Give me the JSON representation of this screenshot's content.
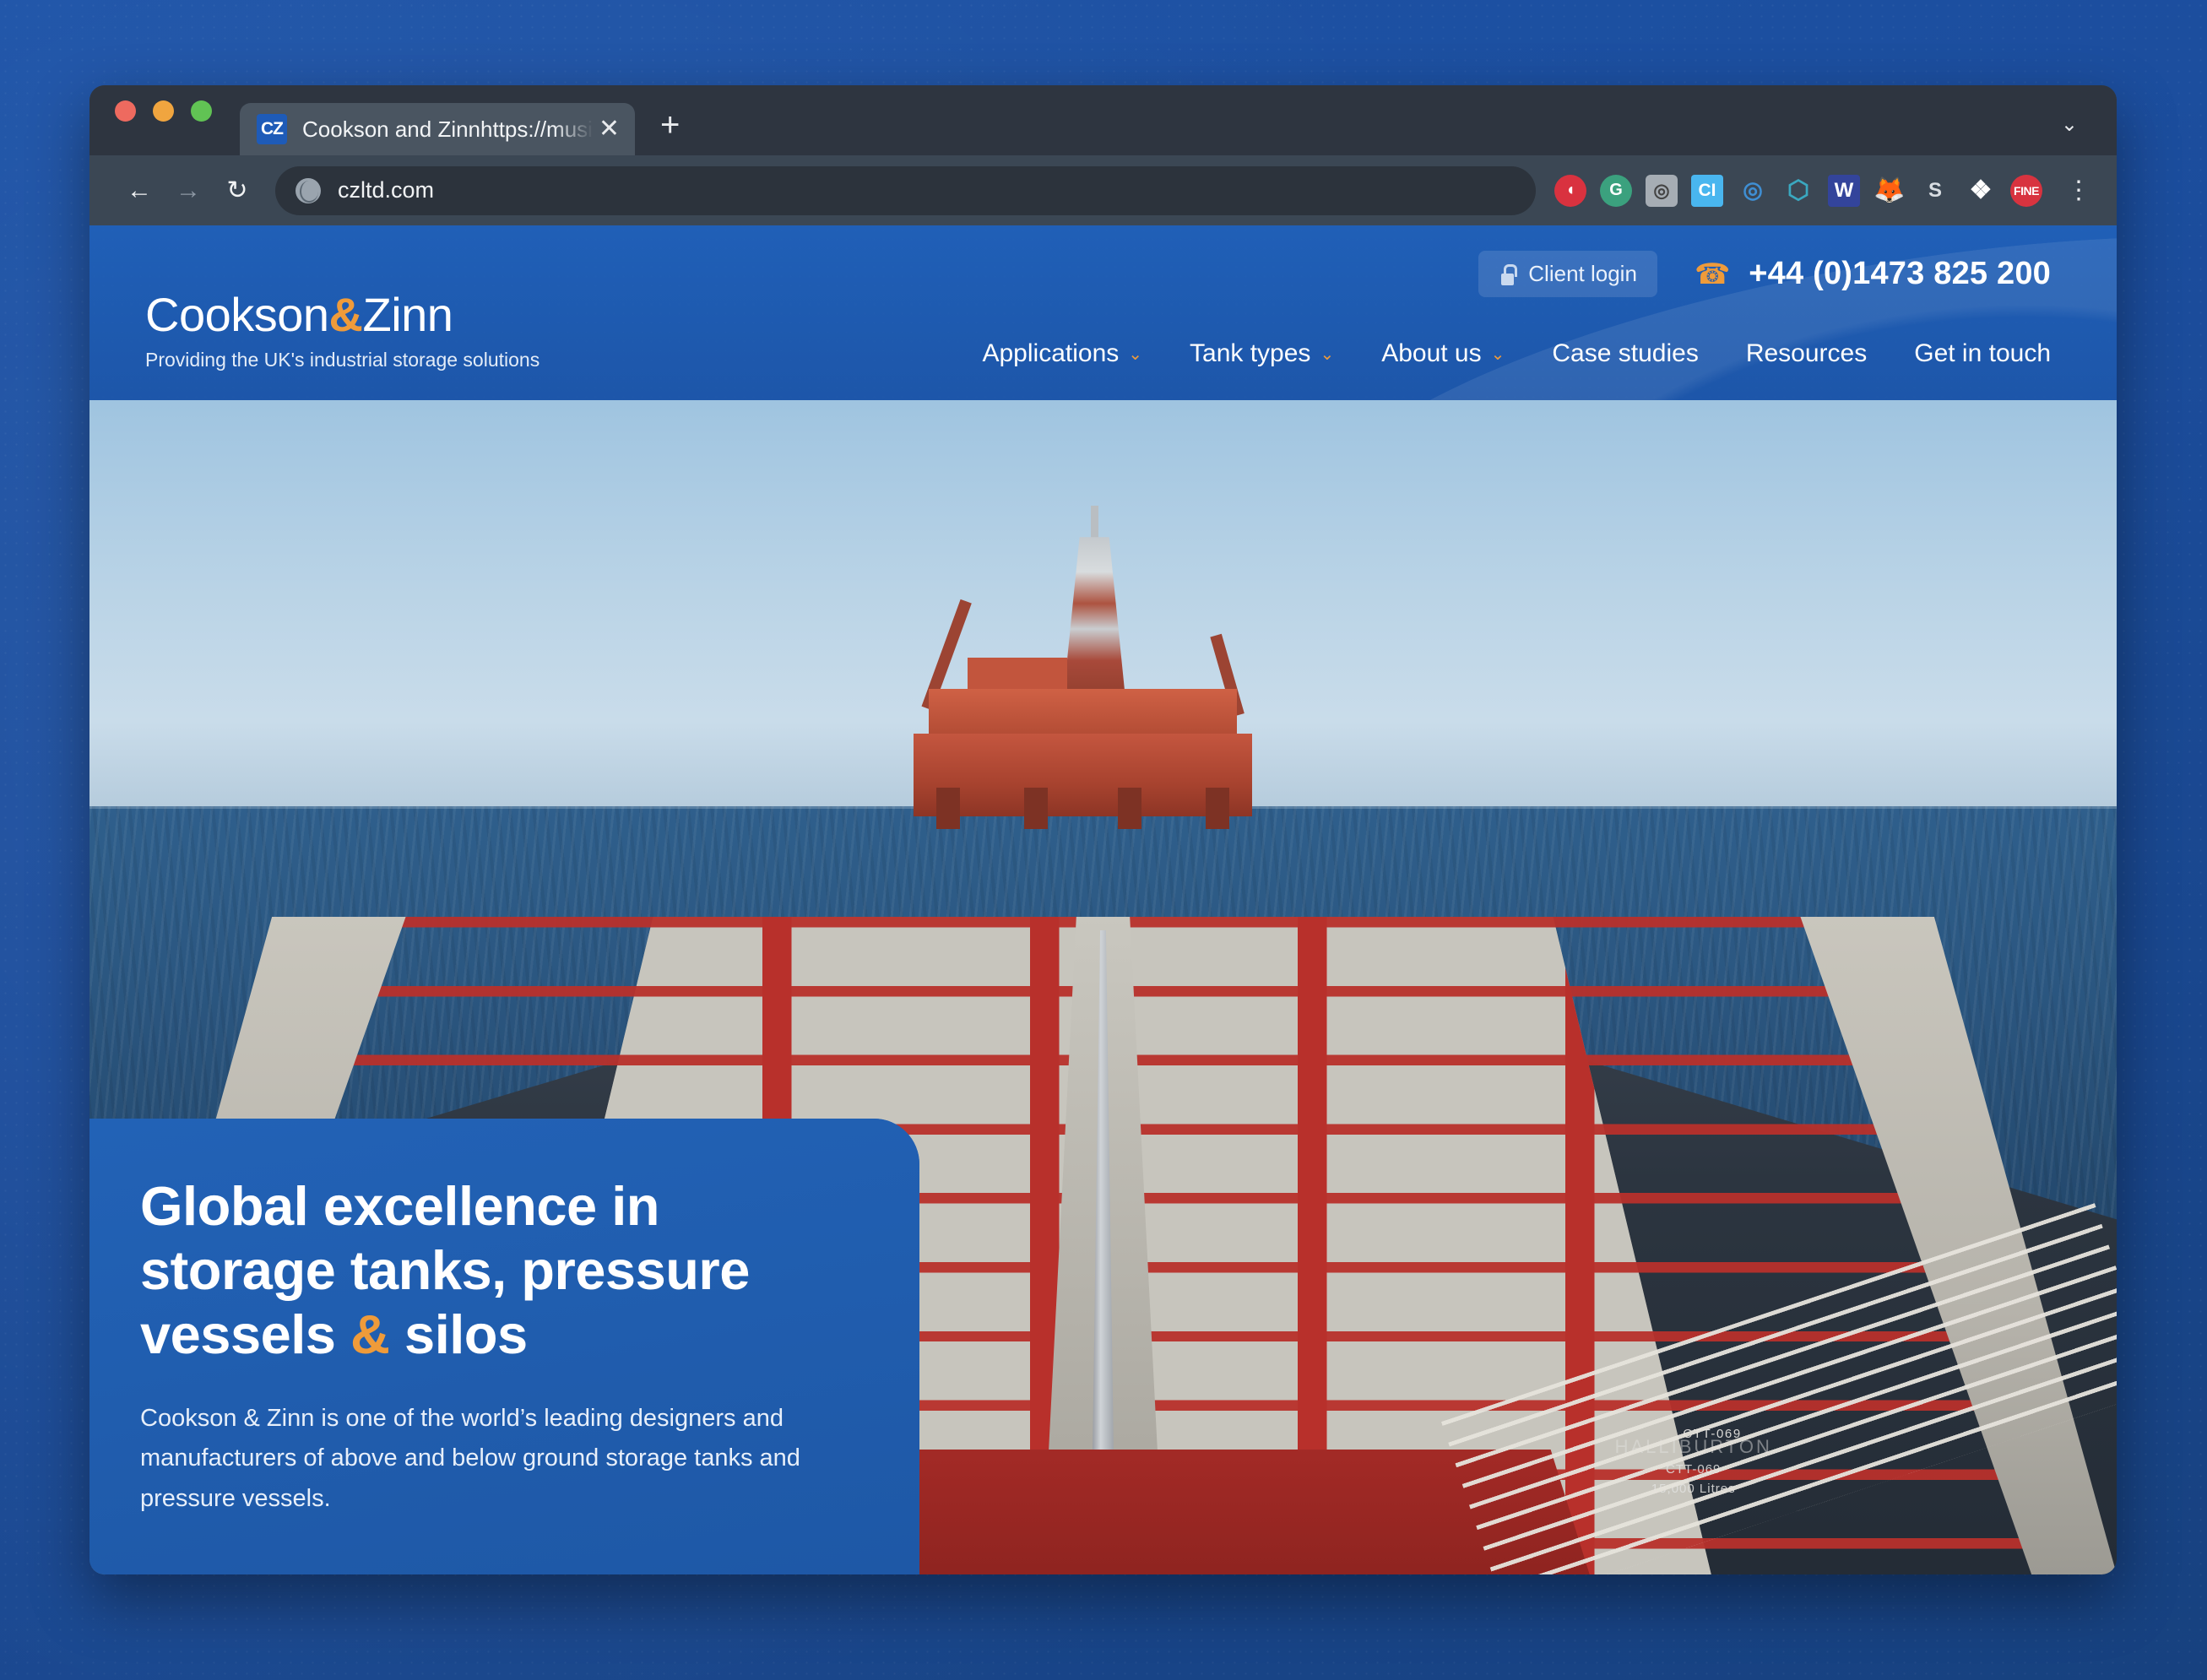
{
  "desktop": {
    "background_color": "#1b4c9b"
  },
  "browser": {
    "tab": {
      "favicon_text": "CZ",
      "title": "Cookson and Zinnhttps://musin",
      "close_label": "✕"
    },
    "new_tab_label": "+",
    "tab_search_icon": "⌄",
    "toolbar": {
      "back_label": "←",
      "forward_label": "→",
      "reload_label": "↻",
      "url": "czltd.com",
      "menu_label": "⋮"
    },
    "extensions": [
      {
        "name": "pocket-extension",
        "glyph": "◖"
      },
      {
        "name": "grammarly-extension",
        "glyph": "G"
      },
      {
        "name": "screenshot-extension",
        "glyph": "◎"
      },
      {
        "name": "ci-extension",
        "glyph": "CI"
      },
      {
        "name": "clarity-extension",
        "glyph": "◎"
      },
      {
        "name": "hook-extension",
        "glyph": "⬡"
      },
      {
        "name": "wordtune-extension",
        "glyph": "W"
      },
      {
        "name": "fox-extension",
        "glyph": "🦊"
      },
      {
        "name": "s-extension",
        "glyph": "S"
      },
      {
        "name": "puzzle-extension",
        "glyph": "❖"
      },
      {
        "name": "fine-extension",
        "glyph": "FINE"
      }
    ]
  },
  "site": {
    "colors": {
      "brand_blue": "#1d58ad",
      "accent_orange": "#ef9b3a",
      "hero_card_blue": "#2160b2"
    },
    "utility": {
      "client_login_label": "Client login",
      "phone_number": "+44 (0)1473 825 200"
    },
    "logo": {
      "part1": "Cookson",
      "ampersand": "&",
      "part2": "Zinn",
      "tagline": "Providing the UK's industrial storage solutions"
    },
    "nav": [
      {
        "label": "Applications",
        "has_caret": true,
        "caret": "⌄"
      },
      {
        "label": "Tank types",
        "has_caret": true,
        "caret": "⌄"
      },
      {
        "label": "About us",
        "has_caret": true,
        "caret": "⌄"
      },
      {
        "label": "Case studies",
        "has_caret": false,
        "caret": ""
      },
      {
        "label": "Resources",
        "has_caret": false,
        "caret": ""
      },
      {
        "label": "Get in touch",
        "has_caret": false,
        "caret": ""
      }
    ],
    "hero": {
      "heading_line1": "Global excellence in",
      "heading_line2": "storage tanks, pressure",
      "heading_line3a": "vessels ",
      "heading_amp": "&",
      "heading_line3b": " silos",
      "paragraph": "Cookson & Zinn is one of the world’s leading designers and manufacturers of above and below ground storage tanks and pressure vessels.",
      "photo": {
        "description": "Cargo ship deck loaded with red tank containers at sea with an offshore oil rig on the horizon",
        "tank_brand": "HALLIBURTON",
        "tank_id": "CTT-069",
        "tank_capacity": "15,000 Litres"
      }
    }
  }
}
